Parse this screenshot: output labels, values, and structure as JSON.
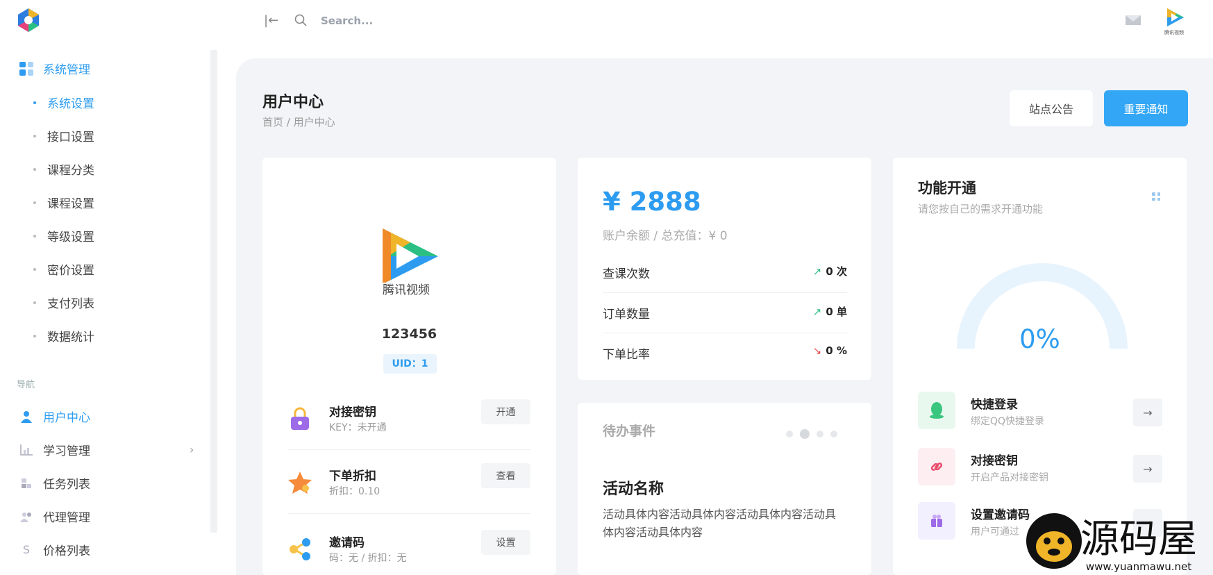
{
  "topbar": {
    "search_placeholder": "Search..."
  },
  "sidebar": {
    "group": "系统管理",
    "sub_items": [
      {
        "label": "系统设置",
        "active": true
      },
      {
        "label": "接口设置"
      },
      {
        "label": "课程分类"
      },
      {
        "label": "课程设置"
      },
      {
        "label": "等级设置"
      },
      {
        "label": "密价设置"
      },
      {
        "label": "支付列表"
      },
      {
        "label": "数据统计"
      }
    ],
    "nav_label": "导航",
    "nav_items": [
      {
        "label": "用户中心",
        "icon": "user-icon",
        "active": true
      },
      {
        "label": "学习管理",
        "icon": "chart-icon"
      },
      {
        "label": "任务列表",
        "icon": "list-icon"
      },
      {
        "label": "代理管理",
        "icon": "agents-icon"
      },
      {
        "label": "价格列表",
        "icon": "s-icon",
        "icon_text": "S"
      }
    ]
  },
  "header": {
    "title": "用户中心",
    "breadcrumb": "首页  /  用户中心",
    "notice_button": "站点公告",
    "important_button": "重要通知"
  },
  "profile": {
    "avatar_text": "腾讯视频",
    "username": "123456",
    "uid": "UID：1",
    "features": [
      {
        "title": "对接密钥",
        "sub": "KEY：未开通",
        "button": "开通",
        "icon": "lock-icon"
      },
      {
        "title": "下单折扣",
        "sub": "折扣：0.10",
        "button": "查看",
        "icon": "star-icon"
      },
      {
        "title": "邀请码",
        "sub": "码：无 / 折扣：无",
        "button": "设置",
        "icon": "share-icon"
      }
    ]
  },
  "balance": {
    "amount": "¥ 2888",
    "sub": "账户余额 / 总充值：¥ 0",
    "stats": [
      {
        "label": "查课次数",
        "value": "0 次",
        "trend": "up"
      },
      {
        "label": "订单数量",
        "value": "0 单",
        "trend": "up"
      },
      {
        "label": "下单比率",
        "value": "0 %",
        "trend": "down"
      }
    ]
  },
  "todo": {
    "title": "待办事件",
    "activity_title": "活动名称",
    "activity_desc": "活动具体内容活动具体内容活动具体内容活动具体内容活动具体内容"
  },
  "functions": {
    "title": "功能开通",
    "subtitle": "请您按自己的需求开通功能",
    "percent": "0%",
    "percent_value": 0,
    "items": [
      {
        "title": "快捷登录",
        "sub": "绑定QQ快捷登录",
        "icon": "qq-icon"
      },
      {
        "title": "对接密钥",
        "sub": "开启产品对接密钥",
        "icon": "link-icon"
      },
      {
        "title": "设置邀请码",
        "sub": "用户可通过",
        "icon": "gift-icon"
      }
    ]
  },
  "watermark": {
    "name": "源码屋",
    "url": "www.yuanmawu.net"
  },
  "colors": {
    "accent": "#2d9cf0",
    "button": "#33a6f5"
  }
}
